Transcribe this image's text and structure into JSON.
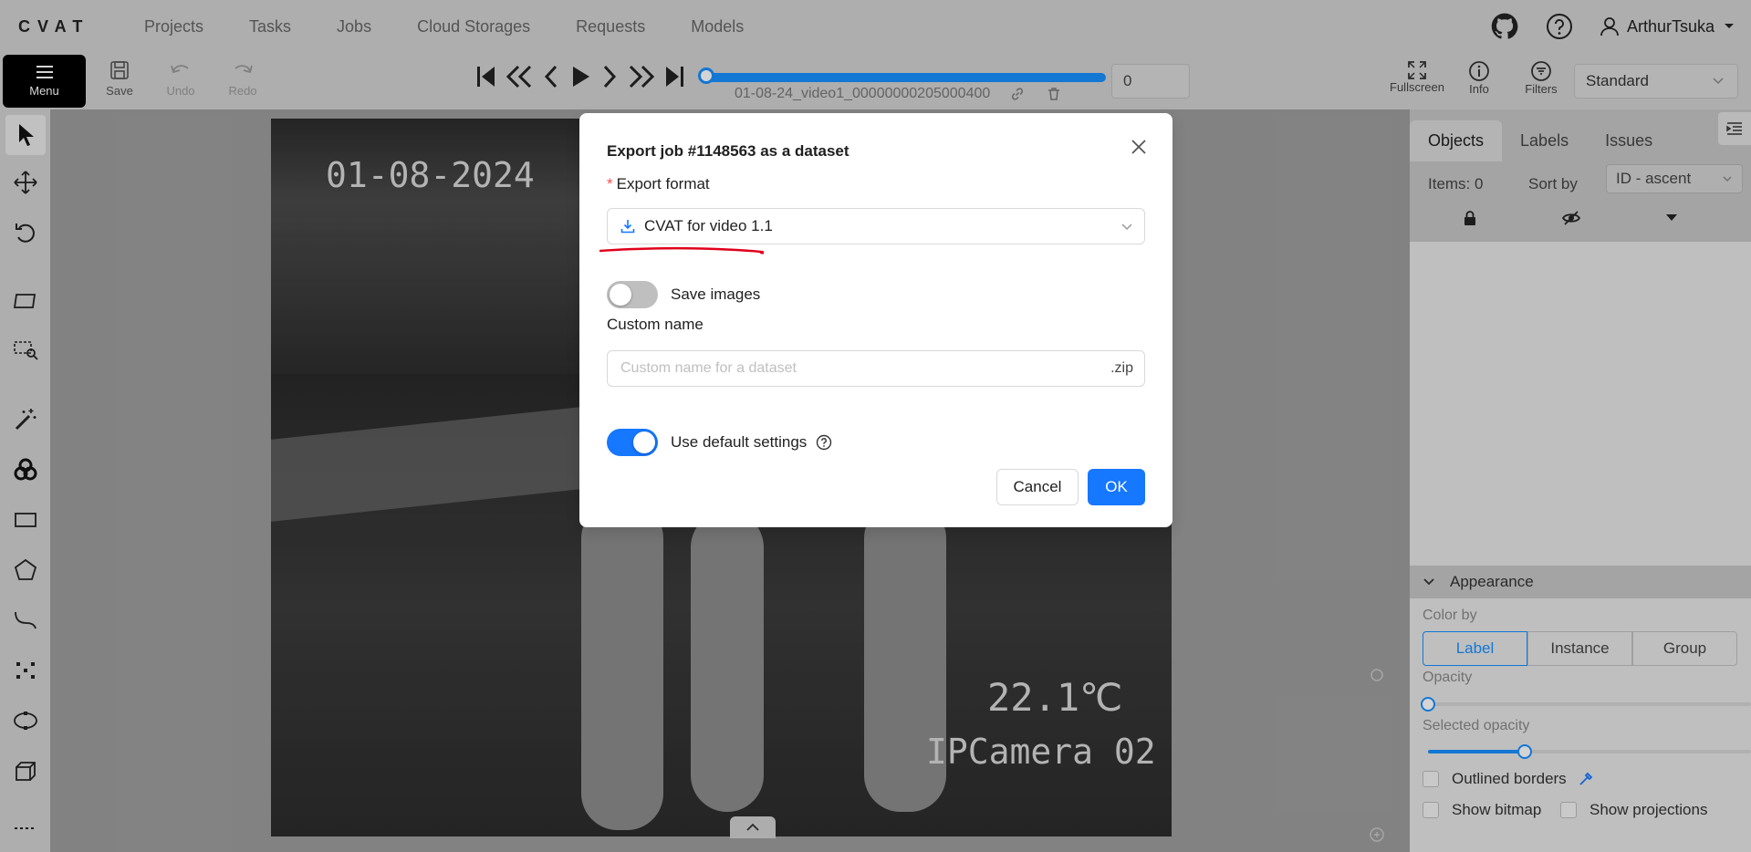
{
  "app": {
    "logo": "CVAT",
    "nav": [
      "Projects",
      "Tasks",
      "Jobs",
      "Cloud Storages",
      "Requests",
      "Models"
    ],
    "user": "ArthurTsuka"
  },
  "toolbar": {
    "menu_label": "Menu",
    "save_label": "Save",
    "undo_label": "Undo",
    "redo_label": "Redo",
    "filename": "01-08-24_video1_00000000205000400",
    "frame_value": "0",
    "fullscreen_label": "Fullscreen",
    "info_label": "Info",
    "filters_label": "Filters",
    "workspace_value": "Standard"
  },
  "canvas": {
    "osd_date": "01-08-2024",
    "osd_temp": "22.1℃",
    "osd_camera": "IPCamera 02"
  },
  "sidepanel": {
    "tabs": [
      "Objects",
      "Labels",
      "Issues"
    ],
    "items_text": "Items: 0",
    "sort_label": "Sort by",
    "sort_value": "ID - ascent",
    "appearance_title": "Appearance",
    "color_by_label": "Color by",
    "color_by_options": [
      "Label",
      "Instance",
      "Group"
    ],
    "color_by_selected": "Label",
    "opacity_label": "Opacity",
    "opacity_value": 0.0,
    "selected_opacity_label": "Selected opacity",
    "selected_opacity_value": 0.3,
    "outlined_borders_label": "Outlined borders",
    "show_bitmap_label": "Show bitmap",
    "show_projections_label": "Show projections"
  },
  "modal": {
    "title": "Export job #1148563 as a dataset",
    "format_label": "Export format",
    "format_value": "CVAT for video 1.1",
    "save_images_label": "Save images",
    "save_images_on": false,
    "custom_name_label": "Custom name",
    "custom_name_placeholder": "Custom name for a dataset",
    "custom_name_suffix": ".zip",
    "default_settings_label": "Use default settings",
    "default_settings_on": true,
    "cancel_label": "Cancel",
    "ok_label": "OK"
  },
  "colors": {
    "accent": "#1677ff",
    "annotation_underline": "#e0001b"
  }
}
